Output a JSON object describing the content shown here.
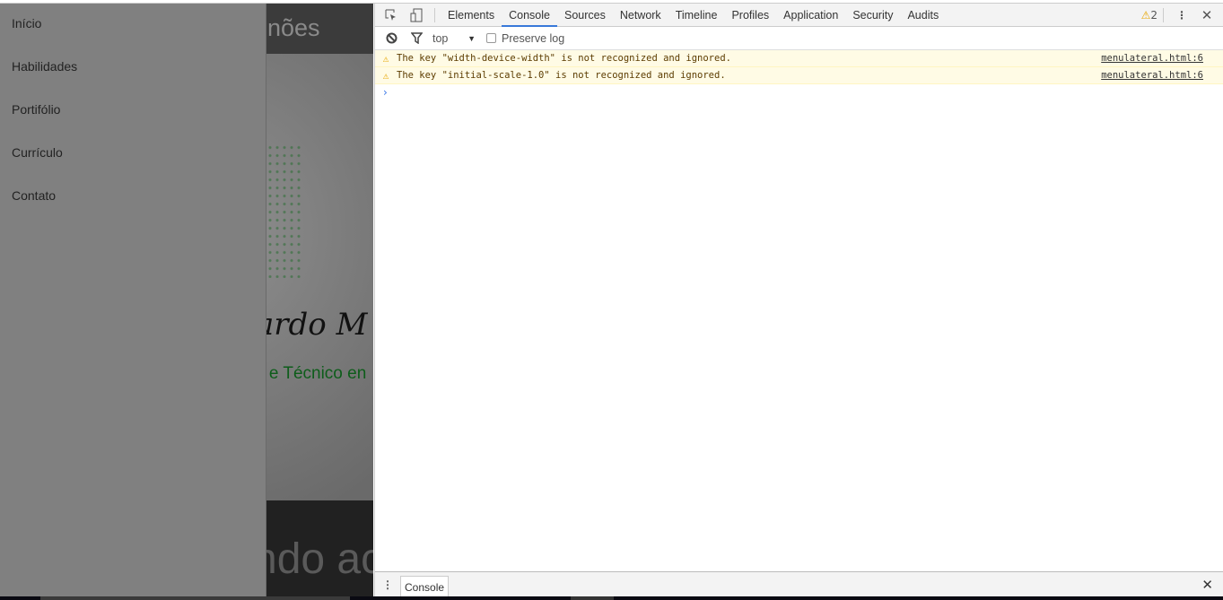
{
  "page": {
    "header_partial": "nões",
    "signature_partial": "ardo M",
    "subtitle_partial": "a e Técnico en",
    "footer_partial": "ndo ac",
    "sidebar": {
      "items": [
        {
          "label": "Início"
        },
        {
          "label": "Habilidades"
        },
        {
          "label": "Portifólio"
        },
        {
          "label": "Currículo"
        },
        {
          "label": "Contato"
        }
      ]
    }
  },
  "devtools": {
    "tabs": [
      {
        "label": "Elements"
      },
      {
        "label": "Console",
        "active": true
      },
      {
        "label": "Sources"
      },
      {
        "label": "Network"
      },
      {
        "label": "Timeline"
      },
      {
        "label": "Profiles"
      },
      {
        "label": "Application"
      },
      {
        "label": "Security"
      },
      {
        "label": "Audits"
      }
    ],
    "warning_count": "2",
    "toolbar": {
      "context": "top",
      "preserve_log_label": "Preserve log",
      "preserve_log_checked": false
    },
    "messages": [
      {
        "level": "warning",
        "text": "The key \"width-device-width\" is not recognized and ignored.",
        "source": "menulateral.html:6"
      },
      {
        "level": "warning",
        "text": "The key \"initial-scale-1.0\" is not recognized and ignored.",
        "source": "menulateral.html:6"
      }
    ],
    "prompt": "›",
    "drawer": {
      "tab": "Console"
    },
    "colors": {
      "accent": "#3879d9",
      "warning_bg": "#fffbe5",
      "warning_icon": "#e7a600"
    }
  }
}
